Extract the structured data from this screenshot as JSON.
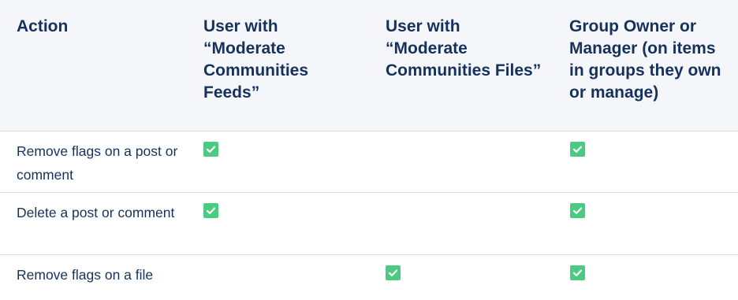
{
  "table": {
    "headers": [
      "Action",
      "User with\n“Moderate\nCommunities\nFeeds”",
      "User with\n“Moderate\nCommunities Files”",
      "Group Owner or\nManager (on items\nin groups they own\nor manage)"
    ],
    "rows": [
      {
        "action": "Remove flags on a post or comment",
        "checks": [
          true,
          false,
          true
        ]
      },
      {
        "action": "Delete a post or comment",
        "checks": [
          true,
          false,
          true
        ]
      },
      {
        "action": "Remove flags on a file",
        "checks": [
          false,
          true,
          true
        ]
      }
    ]
  },
  "colors": {
    "check": "#4bca81",
    "header_bg": "#f4f6f9",
    "text": "#16325c",
    "border": "#d8dde6"
  },
  "icons": {
    "check": "check-icon"
  }
}
